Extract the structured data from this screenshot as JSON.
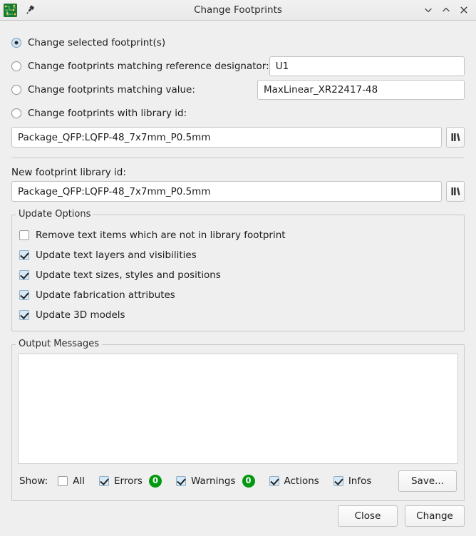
{
  "titlebar": {
    "title": "Change Footprints",
    "app_icon": "kicad-pcb-icon",
    "pin_icon": "pin-icon",
    "minimize_icon": "chevron-down-icon",
    "maximize_icon": "chevron-up-icon",
    "close_icon": "close-icon"
  },
  "mode_options": [
    {
      "id": "selected",
      "label": "Change selected footprint(s)",
      "selected": true,
      "field": null
    },
    {
      "id": "reference",
      "label": "Change footprints matching reference designator:",
      "selected": false,
      "field": {
        "value": "U1",
        "placeholder": ""
      }
    },
    {
      "id": "value",
      "label": "Change footprints matching value:",
      "selected": false,
      "field": {
        "value": "MaxLinear_XR22417-48",
        "placeholder": ""
      }
    },
    {
      "id": "libid",
      "label": "Change footprints with library id:",
      "selected": false,
      "field": {
        "value": "Package_QFP:LQFP-48_7x7mm_P0.5mm",
        "placeholder": ""
      }
    }
  ],
  "new_footprint": {
    "label": "New footprint library id:",
    "value": "Package_QFP:LQFP-48_7x7mm_P0.5mm",
    "placeholder": "",
    "browse_icon": "library-books-icon"
  },
  "update_options": {
    "title": "Update Options",
    "items": [
      {
        "label": "Remove text items which are not in library footprint",
        "checked": false
      },
      {
        "label": "Update text layers and visibilities",
        "checked": true
      },
      {
        "label": "Update text sizes, styles and positions",
        "checked": true
      },
      {
        "label": "Update fabrication attributes",
        "checked": true
      },
      {
        "label": "Update 3D models",
        "checked": true
      }
    ]
  },
  "output_messages": {
    "title": "Output Messages",
    "text": ""
  },
  "show_bar": {
    "label": "Show:",
    "filters": [
      {
        "id": "all",
        "label": "All",
        "checked": false,
        "badge": null
      },
      {
        "id": "errors",
        "label": "Errors",
        "checked": true,
        "badge": "0"
      },
      {
        "id": "warnings",
        "label": "Warnings",
        "checked": true,
        "badge": "0"
      },
      {
        "id": "actions",
        "label": "Actions",
        "checked": true,
        "badge": null
      },
      {
        "id": "infos",
        "label": "Infos",
        "checked": true,
        "badge": null
      }
    ],
    "save_label": "Save...",
    "badge_color": "#00990f"
  },
  "footer": {
    "close_label": "Close",
    "change_label": "Change"
  }
}
